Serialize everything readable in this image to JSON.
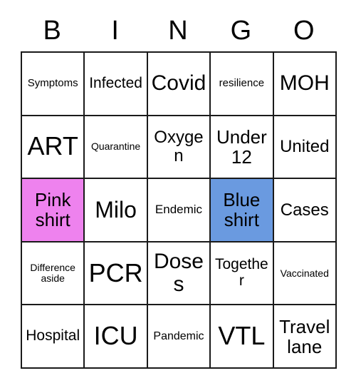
{
  "card": {
    "title": "BINGO",
    "header_letters": [
      "B",
      "I",
      "N",
      "G",
      "O"
    ],
    "colors": {
      "marked_pink": "#ee82ee",
      "marked_blue": "#6a9ae0",
      "grid_line": "#1a1a1a",
      "cell_background": "#ffffff",
      "text": "#000000"
    },
    "rows": [
      [
        {
          "text": "Symptoms",
          "size": "fs-s",
          "fill": "none"
        },
        {
          "text": "Infected",
          "size": "fs-ml",
          "fill": "none"
        },
        {
          "text": "Covid",
          "size": "fs-xxl",
          "fill": "none"
        },
        {
          "text": "resilience",
          "size": "fs-s",
          "fill": "none"
        },
        {
          "text": "MOH",
          "size": "fs-xxl",
          "fill": "none"
        }
      ],
      [
        {
          "text": "ART",
          "size": "fs-h2",
          "fill": "none"
        },
        {
          "text": "Quarantine",
          "size": "fs-xs",
          "fill": "none"
        },
        {
          "text": "Oxygen",
          "size": "fs-l",
          "fill": "none"
        },
        {
          "text": "Under 12",
          "size": "fs-xl",
          "fill": "none"
        },
        {
          "text": "United",
          "size": "fs-l",
          "fill": "none"
        }
      ],
      [
        {
          "text": "Pink shirt",
          "size": "fs-xl",
          "fill": "pink"
        },
        {
          "text": "Milo",
          "size": "fs-h1",
          "fill": "none"
        },
        {
          "text": "Endemic",
          "size": "fs-m",
          "fill": "none"
        },
        {
          "text": "Blue shirt",
          "size": "fs-xl",
          "fill": "blue"
        },
        {
          "text": "Cases",
          "size": "fs-l",
          "fill": "none"
        }
      ],
      [
        {
          "text": "Difference aside",
          "size": "fs-xs",
          "fill": "none"
        },
        {
          "text": "PCR",
          "size": "fs-h2",
          "fill": "none"
        },
        {
          "text": "Doses",
          "size": "fs-xxl",
          "fill": "none"
        },
        {
          "text": "Together",
          "size": "fs-ml",
          "fill": "none"
        },
        {
          "text": "Vaccinated",
          "size": "fs-xs",
          "fill": "none"
        }
      ],
      [
        {
          "text": "Hospital",
          "size": "fs-ml",
          "fill": "none"
        },
        {
          "text": "ICU",
          "size": "fs-h2",
          "fill": "none"
        },
        {
          "text": "Pandemic",
          "size": "fs-sm",
          "fill": "none"
        },
        {
          "text": "VTL",
          "size": "fs-h2",
          "fill": "none"
        },
        {
          "text": "Travel lane",
          "size": "fs-xl",
          "fill": "none"
        }
      ]
    ]
  }
}
